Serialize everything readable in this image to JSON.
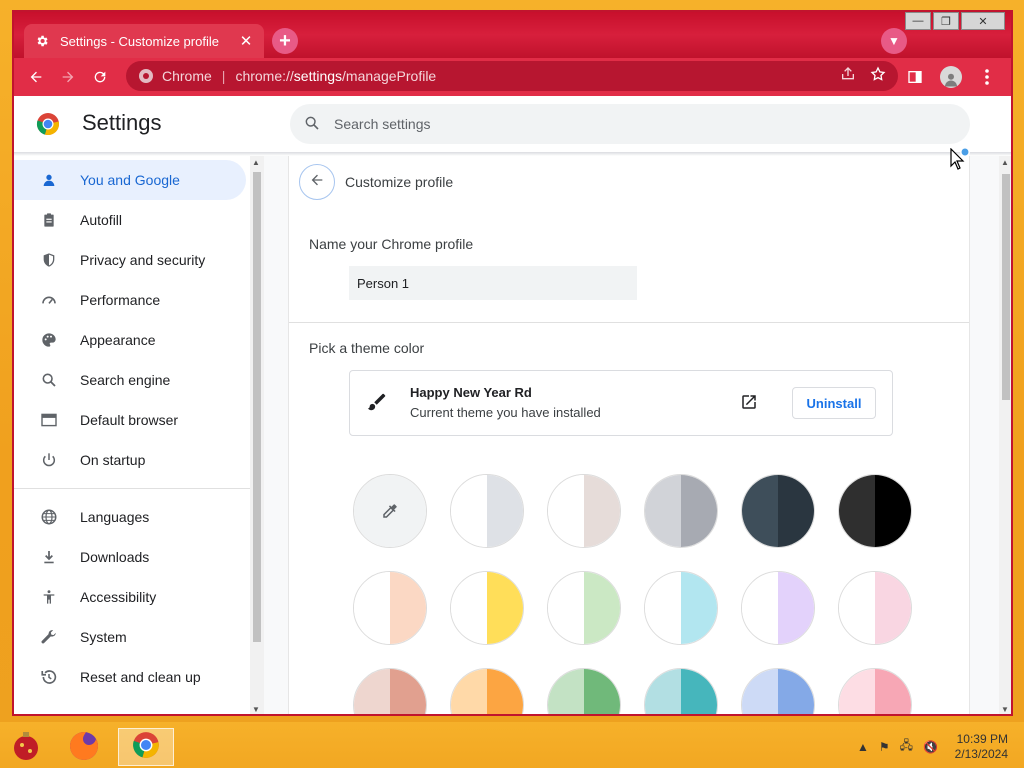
{
  "tab": {
    "title": "Settings - Customize profile",
    "close": "✕",
    "new_tab": "+"
  },
  "window_controls": {
    "minimize": "—",
    "restore": "❐",
    "close": "✕"
  },
  "omnibox": {
    "site_label": "Chrome",
    "url_prefix": "chrome://",
    "url_host": "settings",
    "url_path": "/manageProfile"
  },
  "header": {
    "title": "Settings",
    "search_placeholder": "Search settings"
  },
  "sidebar": {
    "items": [
      {
        "label": "You and Google",
        "icon": "person-icon",
        "active": true
      },
      {
        "label": "Autofill",
        "icon": "clipboard-icon"
      },
      {
        "label": "Privacy and security",
        "icon": "shield-icon"
      },
      {
        "label": "Performance",
        "icon": "speedometer-icon"
      },
      {
        "label": "Appearance",
        "icon": "palette-icon"
      },
      {
        "label": "Search engine",
        "icon": "search-icon"
      },
      {
        "label": "Default browser",
        "icon": "browser-icon"
      },
      {
        "label": "On startup",
        "icon": "power-icon"
      }
    ],
    "items2": [
      {
        "label": "Languages",
        "icon": "globe-icon"
      },
      {
        "label": "Downloads",
        "icon": "download-icon"
      },
      {
        "label": "Accessibility",
        "icon": "accessibility-icon"
      },
      {
        "label": "System",
        "icon": "wrench-icon"
      },
      {
        "label": "Reset and clean up",
        "icon": "restore-icon"
      }
    ]
  },
  "main": {
    "page_title": "Customize profile",
    "name_label": "Name your Chrome profile",
    "name_value": "Person 1",
    "theme_label": "Pick a theme color",
    "theme": {
      "name": "Happy New Year Rd",
      "subtitle": "Current theme you have installed",
      "uninstall": "Uninstall"
    },
    "swatches": [
      [
        "#f1f3f4",
        "#f1f3f4"
      ],
      [
        "#ffffff",
        "#dee1e6"
      ],
      [
        "#ffffff",
        "#e6dcd9"
      ],
      [
        "#d1d3d8",
        "#a7aab2"
      ],
      [
        "#3e4e5a",
        "#2a3640"
      ],
      [
        "#2f2f2f",
        "#000000"
      ],
      [
        "#ffffff",
        "#fbd8c4"
      ],
      [
        "#ffffff",
        "#ffde59"
      ],
      [
        "#ffffff",
        "#cbe8c4"
      ],
      [
        "#ffffff",
        "#b2e6f0"
      ],
      [
        "#ffffff",
        "#e3d2fb"
      ],
      [
        "#ffffff",
        "#f9d6e2"
      ],
      [
        "#eed6cf",
        "#e1a08f"
      ],
      [
        "#ffd9a8",
        "#fca542"
      ],
      [
        "#c3e2c4",
        "#70b97a"
      ],
      [
        "#b2dfe3",
        "#46b6bc"
      ],
      [
        "#cddaf6",
        "#84a9e7"
      ],
      [
        "#fddde4",
        "#f7a7b5"
      ]
    ]
  },
  "taskbar": {
    "time": "10:39 PM",
    "date": "2/13/2024"
  }
}
